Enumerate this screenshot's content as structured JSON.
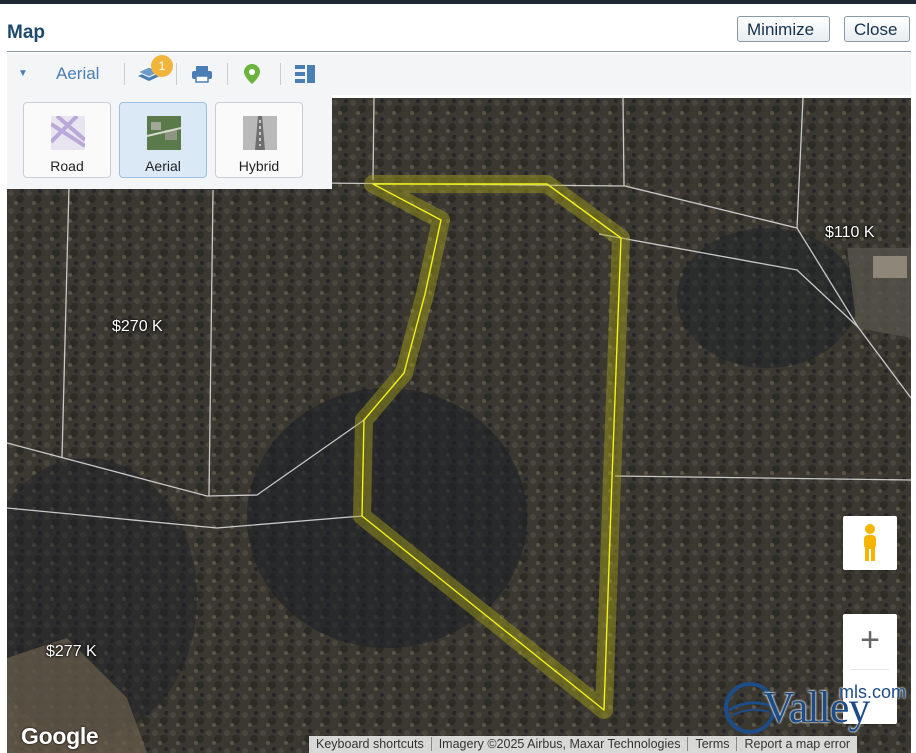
{
  "header": {
    "title": "Map",
    "minimize_label": "Minimize",
    "close_label": "Close"
  },
  "toolbar": {
    "map_type_label": "Aerial",
    "layers_badge": "1",
    "icons": [
      "layers-icon",
      "print-icon",
      "map-pin-icon",
      "list-panel-icon"
    ]
  },
  "map_styles": {
    "items": [
      {
        "label": "Road",
        "active": false
      },
      {
        "label": "Aerial",
        "active": true
      },
      {
        "label": "Hybrid",
        "active": false
      }
    ]
  },
  "map": {
    "price_labels": [
      "$270 K",
      "$110 K",
      "$277 K"
    ],
    "zoom_in_label": "+",
    "google_logo": "Google",
    "attribution": {
      "keyboard": "Keyboard shortcuts",
      "imagery": "Imagery ©2025 Airbus, Maxar Technologies",
      "terms": "Terms",
      "report": "Report a map error"
    },
    "highlight_color": "#f2f21c"
  },
  "brand": {
    "name": "Valley",
    "domain": "mls.com"
  }
}
